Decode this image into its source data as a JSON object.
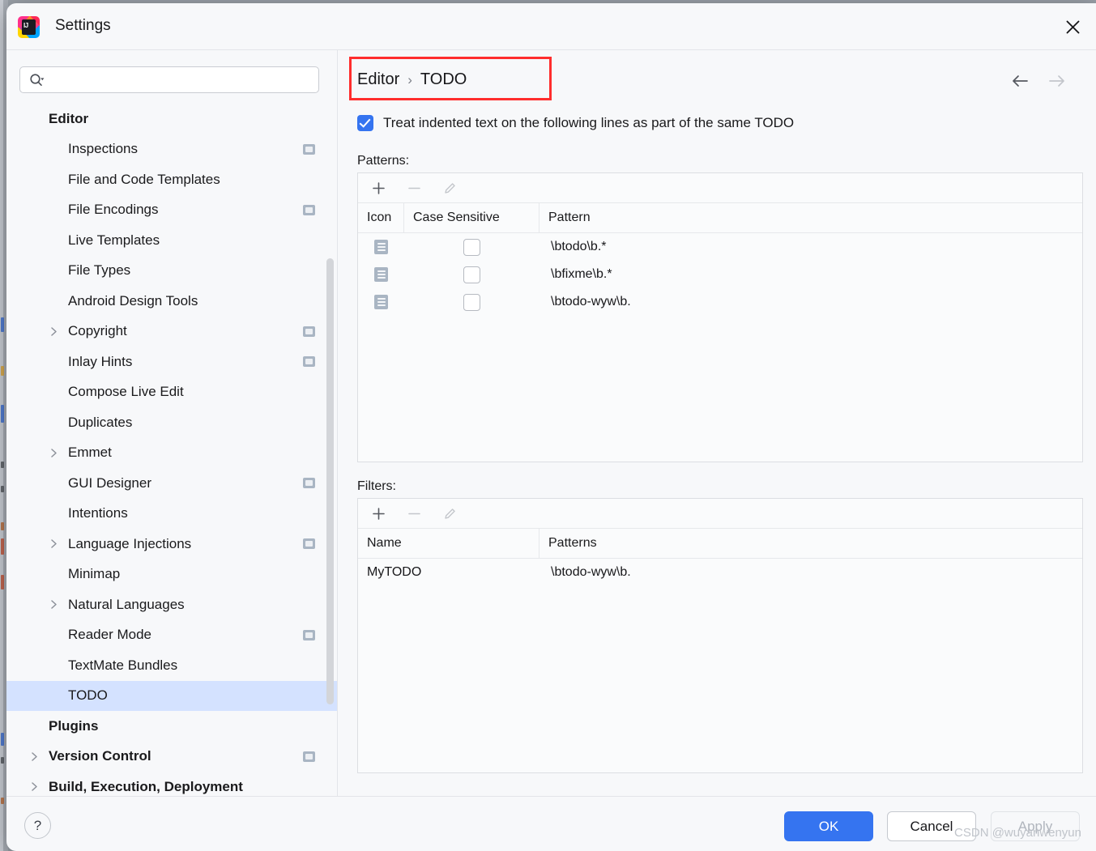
{
  "window": {
    "title": "Settings",
    "logo_icon": "intellij-idea-logo",
    "close_icon": "close-icon"
  },
  "search": {
    "value": "",
    "placeholder": "",
    "icon": "search-icon"
  },
  "sidebar": {
    "items": [
      {
        "label": "Editor",
        "level": 0,
        "group": true,
        "arrow": false,
        "badge": false,
        "selected": false
      },
      {
        "label": "Inspections",
        "level": 1,
        "group": false,
        "arrow": false,
        "badge": true,
        "selected": false
      },
      {
        "label": "File and Code Templates",
        "level": 1,
        "group": false,
        "arrow": false,
        "badge": false,
        "selected": false
      },
      {
        "label": "File Encodings",
        "level": 1,
        "group": false,
        "arrow": false,
        "badge": true,
        "selected": false
      },
      {
        "label": "Live Templates",
        "level": 1,
        "group": false,
        "arrow": false,
        "badge": false,
        "selected": false
      },
      {
        "label": "File Types",
        "level": 1,
        "group": false,
        "arrow": false,
        "badge": false,
        "selected": false
      },
      {
        "label": "Android Design Tools",
        "level": 1,
        "group": false,
        "arrow": false,
        "badge": false,
        "selected": false
      },
      {
        "label": "Copyright",
        "level": 1,
        "group": false,
        "arrow": true,
        "badge": true,
        "selected": false
      },
      {
        "label": "Inlay Hints",
        "level": 1,
        "group": false,
        "arrow": false,
        "badge": true,
        "selected": false
      },
      {
        "label": "Compose Live Edit",
        "level": 1,
        "group": false,
        "arrow": false,
        "badge": false,
        "selected": false
      },
      {
        "label": "Duplicates",
        "level": 1,
        "group": false,
        "arrow": false,
        "badge": false,
        "selected": false
      },
      {
        "label": "Emmet",
        "level": 1,
        "group": false,
        "arrow": true,
        "badge": false,
        "selected": false
      },
      {
        "label": "GUI Designer",
        "level": 1,
        "group": false,
        "arrow": false,
        "badge": true,
        "selected": false
      },
      {
        "label": "Intentions",
        "level": 1,
        "group": false,
        "arrow": false,
        "badge": false,
        "selected": false
      },
      {
        "label": "Language Injections",
        "level": 1,
        "group": false,
        "arrow": true,
        "badge": true,
        "selected": false
      },
      {
        "label": "Minimap",
        "level": 1,
        "group": false,
        "arrow": false,
        "badge": false,
        "selected": false
      },
      {
        "label": "Natural Languages",
        "level": 1,
        "group": false,
        "arrow": true,
        "badge": false,
        "selected": false
      },
      {
        "label": "Reader Mode",
        "level": 1,
        "group": false,
        "arrow": false,
        "badge": true,
        "selected": false
      },
      {
        "label": "TextMate Bundles",
        "level": 1,
        "group": false,
        "arrow": false,
        "badge": false,
        "selected": false
      },
      {
        "label": "TODO",
        "level": 1,
        "group": false,
        "arrow": false,
        "badge": false,
        "selected": true
      },
      {
        "label": "Plugins",
        "level": 0,
        "group": true,
        "arrow": false,
        "badge": false,
        "selected": false
      },
      {
        "label": "Version Control",
        "level": 0,
        "group": true,
        "arrow": true,
        "badge": true,
        "selected": false
      },
      {
        "label": "Build, Execution, Deployment",
        "level": 0,
        "group": true,
        "arrow": true,
        "badge": false,
        "selected": false
      }
    ]
  },
  "main": {
    "breadcrumb": {
      "root": "Editor",
      "separator": "›",
      "current": "TODO"
    },
    "nav": {
      "back_icon": "arrow-left-icon",
      "forward_icon": "arrow-right-icon"
    },
    "indent_option": {
      "label": "Treat indented text on the following lines as part of the same TODO",
      "checked": true
    },
    "patterns": {
      "section_label": "Patterns:",
      "toolbar": [
        {
          "icon": "add-icon",
          "enabled": true
        },
        {
          "icon": "remove-icon",
          "enabled": false
        },
        {
          "icon": "edit-pencil-icon",
          "enabled": false
        }
      ],
      "columns": [
        "Icon",
        "Case Sensitive",
        "Pattern"
      ],
      "rows": [
        {
          "icon": "pattern-list-icon",
          "case_sensitive": false,
          "pattern": "\\btodo\\b.*"
        },
        {
          "icon": "pattern-list-icon",
          "case_sensitive": false,
          "pattern": "\\bfixme\\b.*"
        },
        {
          "icon": "pattern-list-icon",
          "case_sensitive": false,
          "pattern": "\\btodo-wyw\\b."
        }
      ]
    },
    "filters": {
      "section_label": "Filters:",
      "toolbar": [
        {
          "icon": "add-icon",
          "enabled": true
        },
        {
          "icon": "remove-icon",
          "enabled": false
        },
        {
          "icon": "edit-pencil-icon",
          "enabled": false
        }
      ],
      "columns": [
        "Name",
        "Patterns"
      ],
      "rows": [
        {
          "name": "MyTODO",
          "patterns": "\\btodo-wyw\\b."
        }
      ]
    }
  },
  "footer": {
    "help_label": "?",
    "ok_label": "OK",
    "cancel_label": "Cancel",
    "apply_label": "Apply",
    "apply_enabled": false
  },
  "watermark": "CSDN @wuyanwenyun",
  "colors": {
    "accent": "#3574f0",
    "selection": "#d4e2ff",
    "annotation": "#ff2d2d",
    "icon_gray_blue": "#a9b5c3"
  }
}
